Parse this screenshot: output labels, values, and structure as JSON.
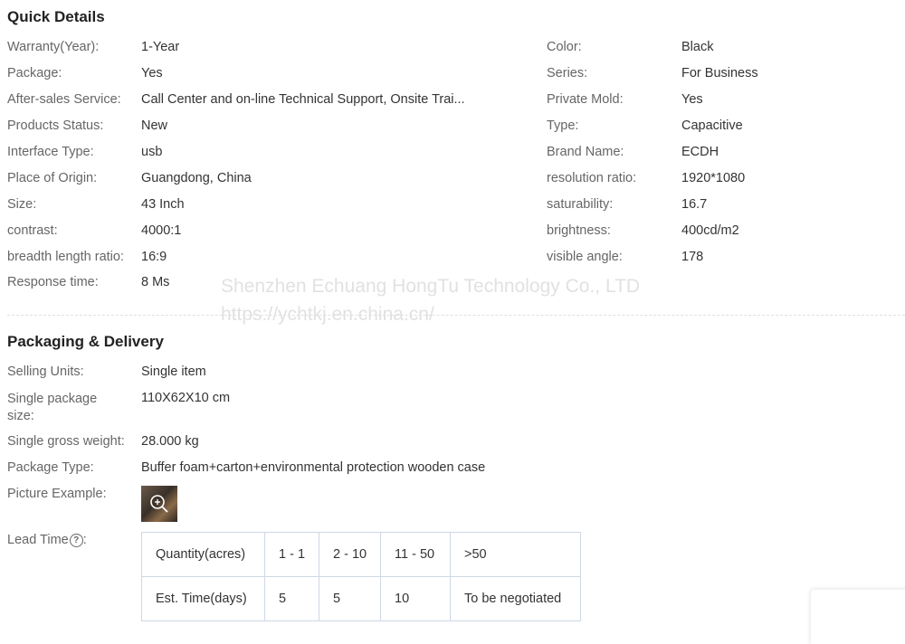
{
  "quick_details": {
    "title": "Quick Details",
    "left": [
      {
        "key": "Warranty(Year):",
        "value": "1-Year"
      },
      {
        "key": "Package:",
        "value": "Yes"
      },
      {
        "key": "After-sales Service:",
        "value": "Call Center and on-line Technical Support, Onsite Trai..."
      },
      {
        "key": "Products Status:",
        "value": "New"
      },
      {
        "key": "Interface Type:",
        "value": "usb"
      },
      {
        "key": "Place of Origin:",
        "value": "Guangdong, China"
      },
      {
        "key": "Size:",
        "value": "43 Inch"
      },
      {
        "key": "contrast:",
        "value": "4000:1"
      },
      {
        "key": "breadth length ratio:",
        "value": "16:9"
      },
      {
        "key": "Response time:",
        "value": "8 Ms"
      }
    ],
    "right": [
      {
        "key": "Color:",
        "value": "Black"
      },
      {
        "key": "Series:",
        "value": "For Business"
      },
      {
        "key": "Private Mold:",
        "value": "Yes"
      },
      {
        "key": "Type:",
        "value": "Capacitive"
      },
      {
        "key": "Brand Name:",
        "value": "ECDH"
      },
      {
        "key": "resolution ratio:",
        "value": "1920*1080"
      },
      {
        "key": "saturability:",
        "value": "16.7"
      },
      {
        "key": "brightness:",
        "value": "400cd/m2"
      },
      {
        "key": "visible angle:",
        "value": "178"
      }
    ]
  },
  "watermark": {
    "line1": "Shenzhen Echuang HongTu Technology Co., LTD",
    "line2": "https://ychtkj.en.china.cn/"
  },
  "packaging": {
    "title": "Packaging & Delivery",
    "rows": [
      {
        "key": "Selling Units:",
        "value": "Single item"
      },
      {
        "key": "Single package size:",
        "value": "110X62X10 cm"
      },
      {
        "key": "Single gross weight:",
        "value": "28.000 kg"
      },
      {
        "key": "Package Type:",
        "value": "Buffer foam+carton+environmental protection wooden case"
      },
      {
        "key": "Picture Example:",
        "value": ""
      }
    ],
    "picture_icon": "zoom-in-icon",
    "lead_time_label": "Lead Time",
    "help_icon": "question-circle-icon",
    "lead_table": {
      "header": [
        "Quantity(acres)",
        "1 - 1",
        "2 - 10",
        "11 - 50",
        ">50"
      ],
      "row": [
        "Est. Time(days)",
        "5",
        "5",
        "10",
        "To be negotiated"
      ]
    }
  }
}
